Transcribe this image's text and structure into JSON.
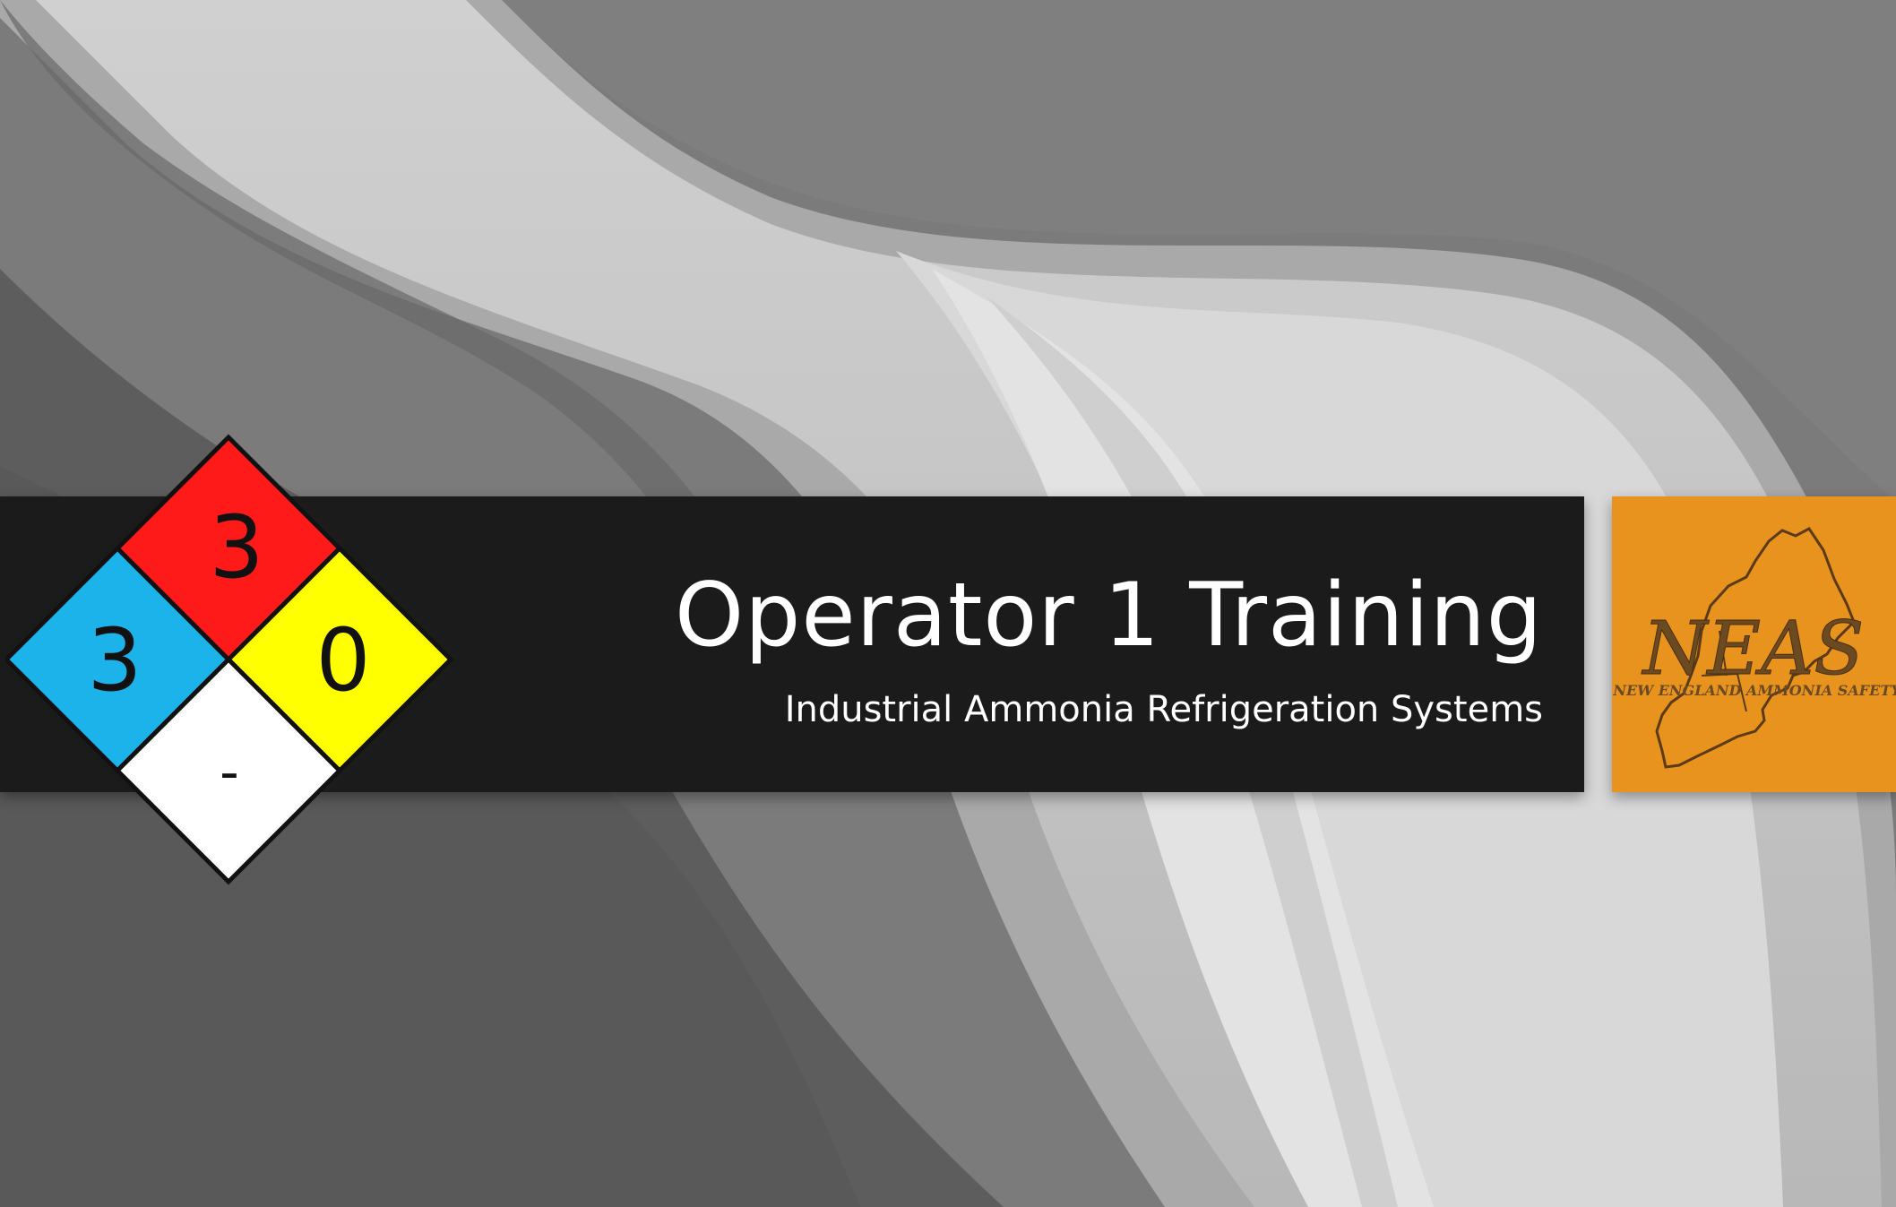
{
  "slide": {
    "title": "Operator 1 Training",
    "subtitle": "Industrial Ammonia Refrigeration Systems"
  },
  "nfpa_diamond": {
    "flammability": "3",
    "health": "3",
    "instability": "0",
    "special": "-",
    "colors": {
      "flammability": "#ff1a1a",
      "health": "#1cb3ea",
      "instability": "#ffff00",
      "special": "#ffffff"
    }
  },
  "logo": {
    "name": "NEAS",
    "tagline": "NEW ENGLAND AMMONIA SAFETY",
    "background": "#e8931e"
  },
  "colors": {
    "band": "#1b1b1b",
    "background": "#6e6e6e"
  }
}
